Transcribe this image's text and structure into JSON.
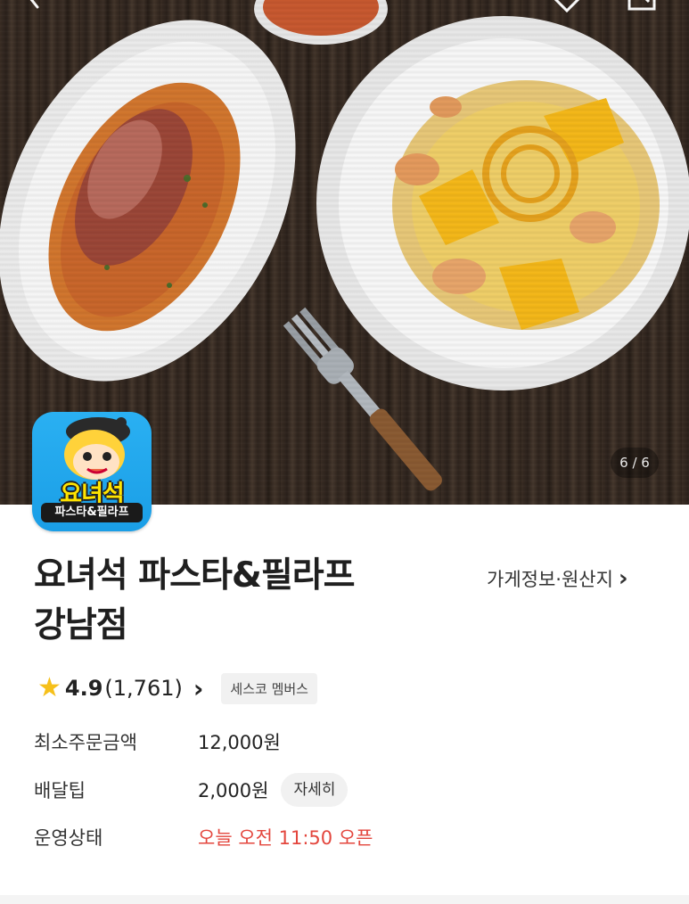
{
  "header": {
    "back_icon": "back-arrow-icon",
    "favorite_icon": "heart-icon",
    "share_icon": "share-icon"
  },
  "gallery": {
    "counter": "6 / 6",
    "progress": 1.0
  },
  "logo": {
    "title": "요녀석",
    "subtitle": "파스타&필라프"
  },
  "store": {
    "name_line1": "요녀석 파스타&필라프",
    "name_line2": "강남점",
    "info_link": "가게정보·원산지",
    "info_chevron": "›"
  },
  "rating": {
    "icon": "star-icon",
    "score": "4.9",
    "count": "(1,761)",
    "chevron": "›",
    "badge": "세스코 멤버스"
  },
  "details": {
    "min_order_label": "최소주문금액",
    "min_order_value": "12,000원",
    "delivery_tip_label": "배달팁",
    "delivery_tip_value": "2,000원",
    "delivery_tip_button": "자세히",
    "status_label": "운영상태",
    "status_value": "오늘 오전 11:50 오픈"
  },
  "colors": {
    "accent_red": "#e3463d",
    "star_yellow": "#f6c01a",
    "logo_blue": "#1a9ee6"
  }
}
